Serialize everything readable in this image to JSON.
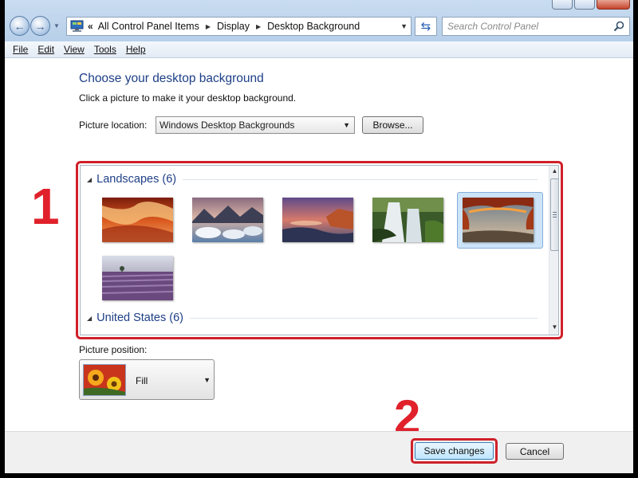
{
  "window": {
    "breadcrumbs": [
      "All Control Panel Items",
      "Display",
      "Desktop Background"
    ],
    "search_placeholder": "Search Control Panel"
  },
  "menu": [
    {
      "label": "File"
    },
    {
      "label": "Edit"
    },
    {
      "label": "View"
    },
    {
      "label": "Tools"
    },
    {
      "label": "Help"
    }
  ],
  "main": {
    "title": "Choose your desktop background",
    "instruction": "Click a picture to make it your desktop background.",
    "picture_location_label": "Picture location:",
    "picture_location_value": "Windows Desktop Backgrounds",
    "browse_label": "Browse...",
    "groups": [
      {
        "label": "Landscapes (6)",
        "selected_index": 4
      },
      {
        "label": "United States (6)"
      }
    ],
    "picture_position_label": "Picture position:",
    "picture_position_value": "Fill"
  },
  "annotations": {
    "step1": "1",
    "step2": "2",
    "accent": "#d0202a"
  },
  "footer": {
    "save_label": "Save changes",
    "cancel_label": "Cancel"
  },
  "icons": [
    "back-arrow-icon",
    "forward-arrow-icon",
    "control-panel-icon",
    "refresh-icon",
    "search-icon",
    "collapse-triangle-icon",
    "dropdown-arrow-icon"
  ]
}
